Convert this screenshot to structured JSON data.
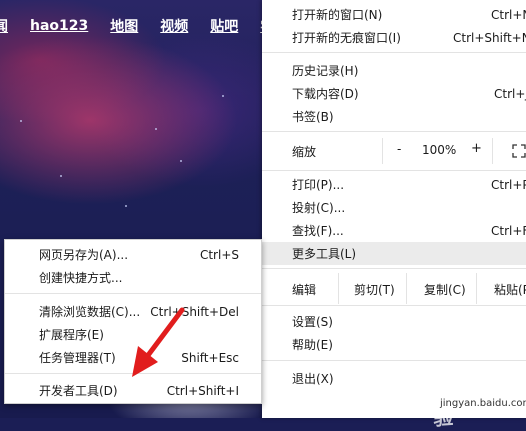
{
  "nav": {
    "links": [
      "闻",
      "hao123",
      "地图",
      "视频",
      "贴吧",
      "学"
    ]
  },
  "main_menu": {
    "new_window": {
      "label": "打开新的窗口(N)",
      "shortcut": "Ctrl+N"
    },
    "new_incognito": {
      "label": "打开新的无痕窗口(I)",
      "shortcut": "Ctrl+Shift+N"
    },
    "history": {
      "label": "历史记录(H)"
    },
    "downloads": {
      "label": "下载内容(D)",
      "shortcut": "Ctrl+J"
    },
    "bookmarks": {
      "label": "书签(B)"
    },
    "zoom": {
      "label": "缩放",
      "minus": "-",
      "value": "100%",
      "plus": "+"
    },
    "print": {
      "label": "打印(P)...",
      "shortcut": "Ctrl+P"
    },
    "cast": {
      "label": "投射(C)..."
    },
    "find": {
      "label": "查找(F)...",
      "shortcut": "Ctrl+F"
    },
    "more_tools": {
      "label": "更多工具(L)"
    },
    "edit": {
      "label": "编辑",
      "cut": "剪切(T)",
      "copy": "复制(C)",
      "paste": "粘贴(P)"
    },
    "settings": {
      "label": "设置(S)"
    },
    "help": {
      "label": "帮助(E)"
    },
    "exit": {
      "label": "退出(X)"
    }
  },
  "sub_menu": {
    "save_page": {
      "label": "网页另存为(A)...",
      "shortcut": "Ctrl+S"
    },
    "create_shortcut": {
      "label": "创建快捷方式..."
    },
    "clear_data": {
      "label": "清除浏览数据(C)...",
      "shortcut": "Ctrl+Shift+Del"
    },
    "extensions": {
      "label": "扩展程序(E)"
    },
    "task_manager": {
      "label": "任务管理器(T)",
      "shortcut": "Shift+Esc"
    },
    "dev_tools": {
      "label": "开发者工具(D)",
      "shortcut": "Ctrl+Shift+I"
    }
  },
  "watermark": {
    "text": "Baidu经验",
    "url": "jingyan.baidu.com"
  },
  "colors": {
    "arrow": "#e11d1d",
    "highlight": "#ebebeb",
    "background": "#1b1e55"
  }
}
